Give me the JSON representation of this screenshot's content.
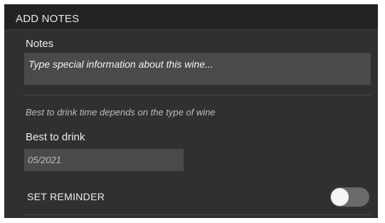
{
  "section": {
    "title": "ADD NOTES"
  },
  "notes": {
    "label": "Notes",
    "placeholder": "Type special information about this wine..."
  },
  "best_to_drink": {
    "hint": "Best to drink time depends on the type of wine",
    "label": "Best to drink",
    "value": "05/2021"
  },
  "reminder": {
    "label": "SET REMINDER",
    "enabled": false
  },
  "colors": {
    "panel_background": "#303030",
    "header_background": "#232323",
    "input_background": "#4a4a4a",
    "toggle_off_track": "#6a6a6a",
    "toggle_knob": "#f5f5f5"
  }
}
